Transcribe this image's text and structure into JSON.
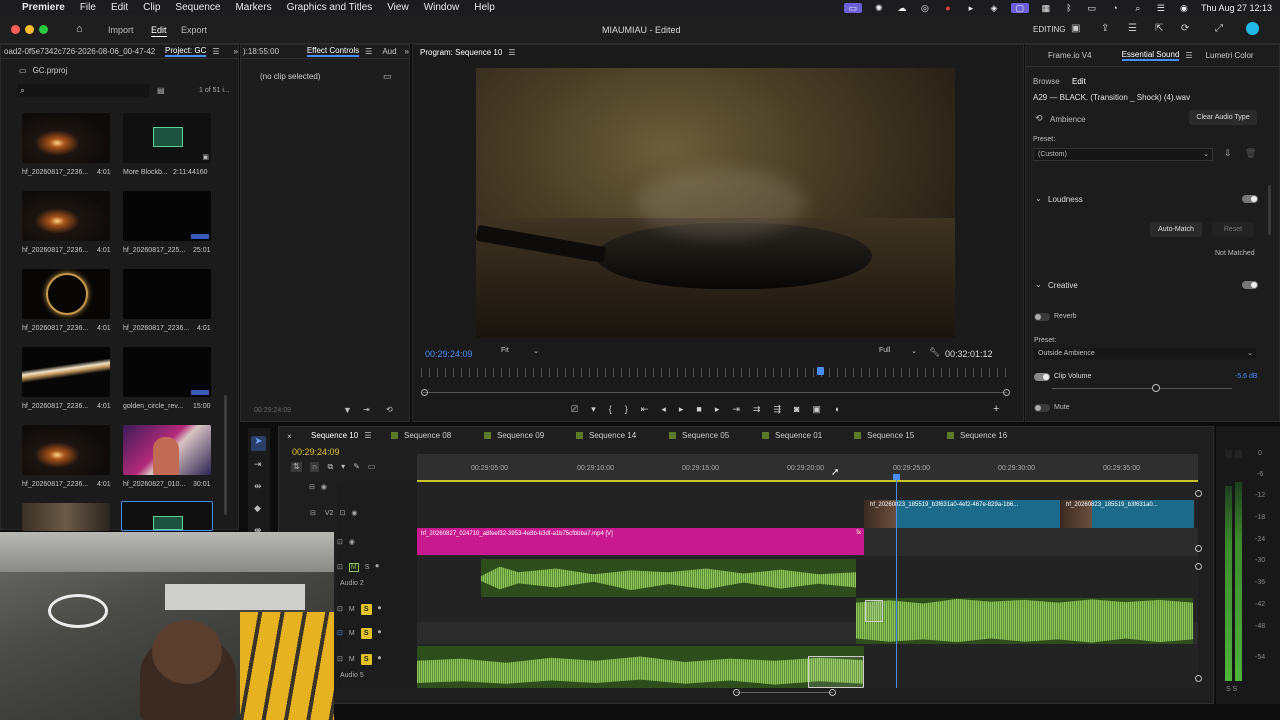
{
  "menubar": {
    "app": "Premiere",
    "items": [
      "File",
      "Edit",
      "Clip",
      "Sequence",
      "Markers",
      "Graphics and Titles",
      "View",
      "Window",
      "Help"
    ],
    "clock": "Thu Aug 27  12:13"
  },
  "window": {
    "title": "MIAUMIAU - Edited",
    "nav": {
      "import": "Import",
      "edit": "Edit",
      "export": "Export"
    },
    "workspace": "EDITING"
  },
  "project": {
    "header_left": "oad2-0f5e7342c726-2026-08-06_00-47-42",
    "tab": "Project: GC",
    "file": "GC.prproj",
    "count": "1 of 51 i...",
    "items": [
      {
        "name": "hf_20260817_2236...",
        "dur": "4:01"
      },
      {
        "name": "More Blockb...",
        "dur": "2:11:44160"
      },
      {
        "name": "hf_20260817_2236...",
        "dur": "4:01"
      },
      {
        "name": "hf_20260817_225...",
        "dur": "25:01"
      },
      {
        "name": "hf_20260817_2236...",
        "dur": "4:01"
      },
      {
        "name": "hf_20260817_2236...",
        "dur": "4:01"
      },
      {
        "name": "hf_20260817_2236...",
        "dur": "4:01"
      },
      {
        "name": "golden_circle_rev...",
        "dur": "15:00"
      },
      {
        "name": "hf_20260817_2236...",
        "dur": "4:01"
      },
      {
        "name": "hf_20260827_010...",
        "dur": "30:01"
      }
    ]
  },
  "effects": {
    "left_time": "):18:55:00",
    "tab": "Effect Controls",
    "tab2": "Aud",
    "noclip": "(no clip selected)",
    "bottom_time": "00:29:24:09"
  },
  "program": {
    "title": "Program: Sequence 10",
    "timecode": "00:29:24:09",
    "fit": "Fit",
    "full": "Full",
    "duration": "00:32:01:12"
  },
  "essential": {
    "tabs": [
      "Frame.io V4",
      "Essential Sound",
      "Lumetri Color"
    ],
    "subtabs": [
      "Browse",
      "Edit"
    ],
    "clip": "A29 — BLACK. (Transition _ Shock) (4).wav",
    "type": "Ambience",
    "clear": "Clear Audio Type",
    "preset_label": "Preset:",
    "preset": "(Custom)",
    "loudness": "Loudness",
    "automatch": "Auto-Match",
    "reset": "Reset",
    "notmatched": "Not Matched",
    "creative": "Creative",
    "reverb": "Reverb",
    "preset2_label": "Preset:",
    "preset2": "Outside Ambience",
    "clipvolume": "Clip Volume",
    "volume_val": "-5.6 dB",
    "volume_level": 0.58,
    "mute": "Mute"
  },
  "timeline": {
    "tabs": [
      "Sequence 10",
      "Sequence 08",
      "Sequence 09",
      "Sequence 14",
      "Sequence 05",
      "Sequence 01",
      "Sequence 15",
      "Sequence 16"
    ],
    "timecode": "00:29:24:09",
    "ruler": [
      "00:29:05:00",
      "00:29:10:00",
      "00:29:15:00",
      "00:29:20:00",
      "00:29:25:00",
      "00:29:30:00",
      "00:29:35:00"
    ],
    "tracks": {
      "v2": "V2",
      "a2": "Audio 2",
      "a5": "Audio 5"
    },
    "clip_v1": "hf_20260827_024710_a8feef32-3953-4e8b-b3df-a1b75cfbbba7.mp4 [V]",
    "clip_v2a": "hf_20260823_185519_b3f631a0-4ef2-467e-829a-1b6...",
    "clip_v2b": "hf_20260823_185519_b3f631a0..."
  },
  "meter": {
    "labels": [
      "0",
      "-6",
      "-12",
      "-18",
      "-24",
      "-30",
      "-36",
      "-42",
      "-48",
      "-54"
    ],
    "ss": "S  S"
  },
  "colors": {
    "accent": "#4b8df8",
    "magenta": "#c8198f",
    "audio": "#8ec45a",
    "video_teal": "#1c6a8a",
    "solo": "#e1c327"
  }
}
